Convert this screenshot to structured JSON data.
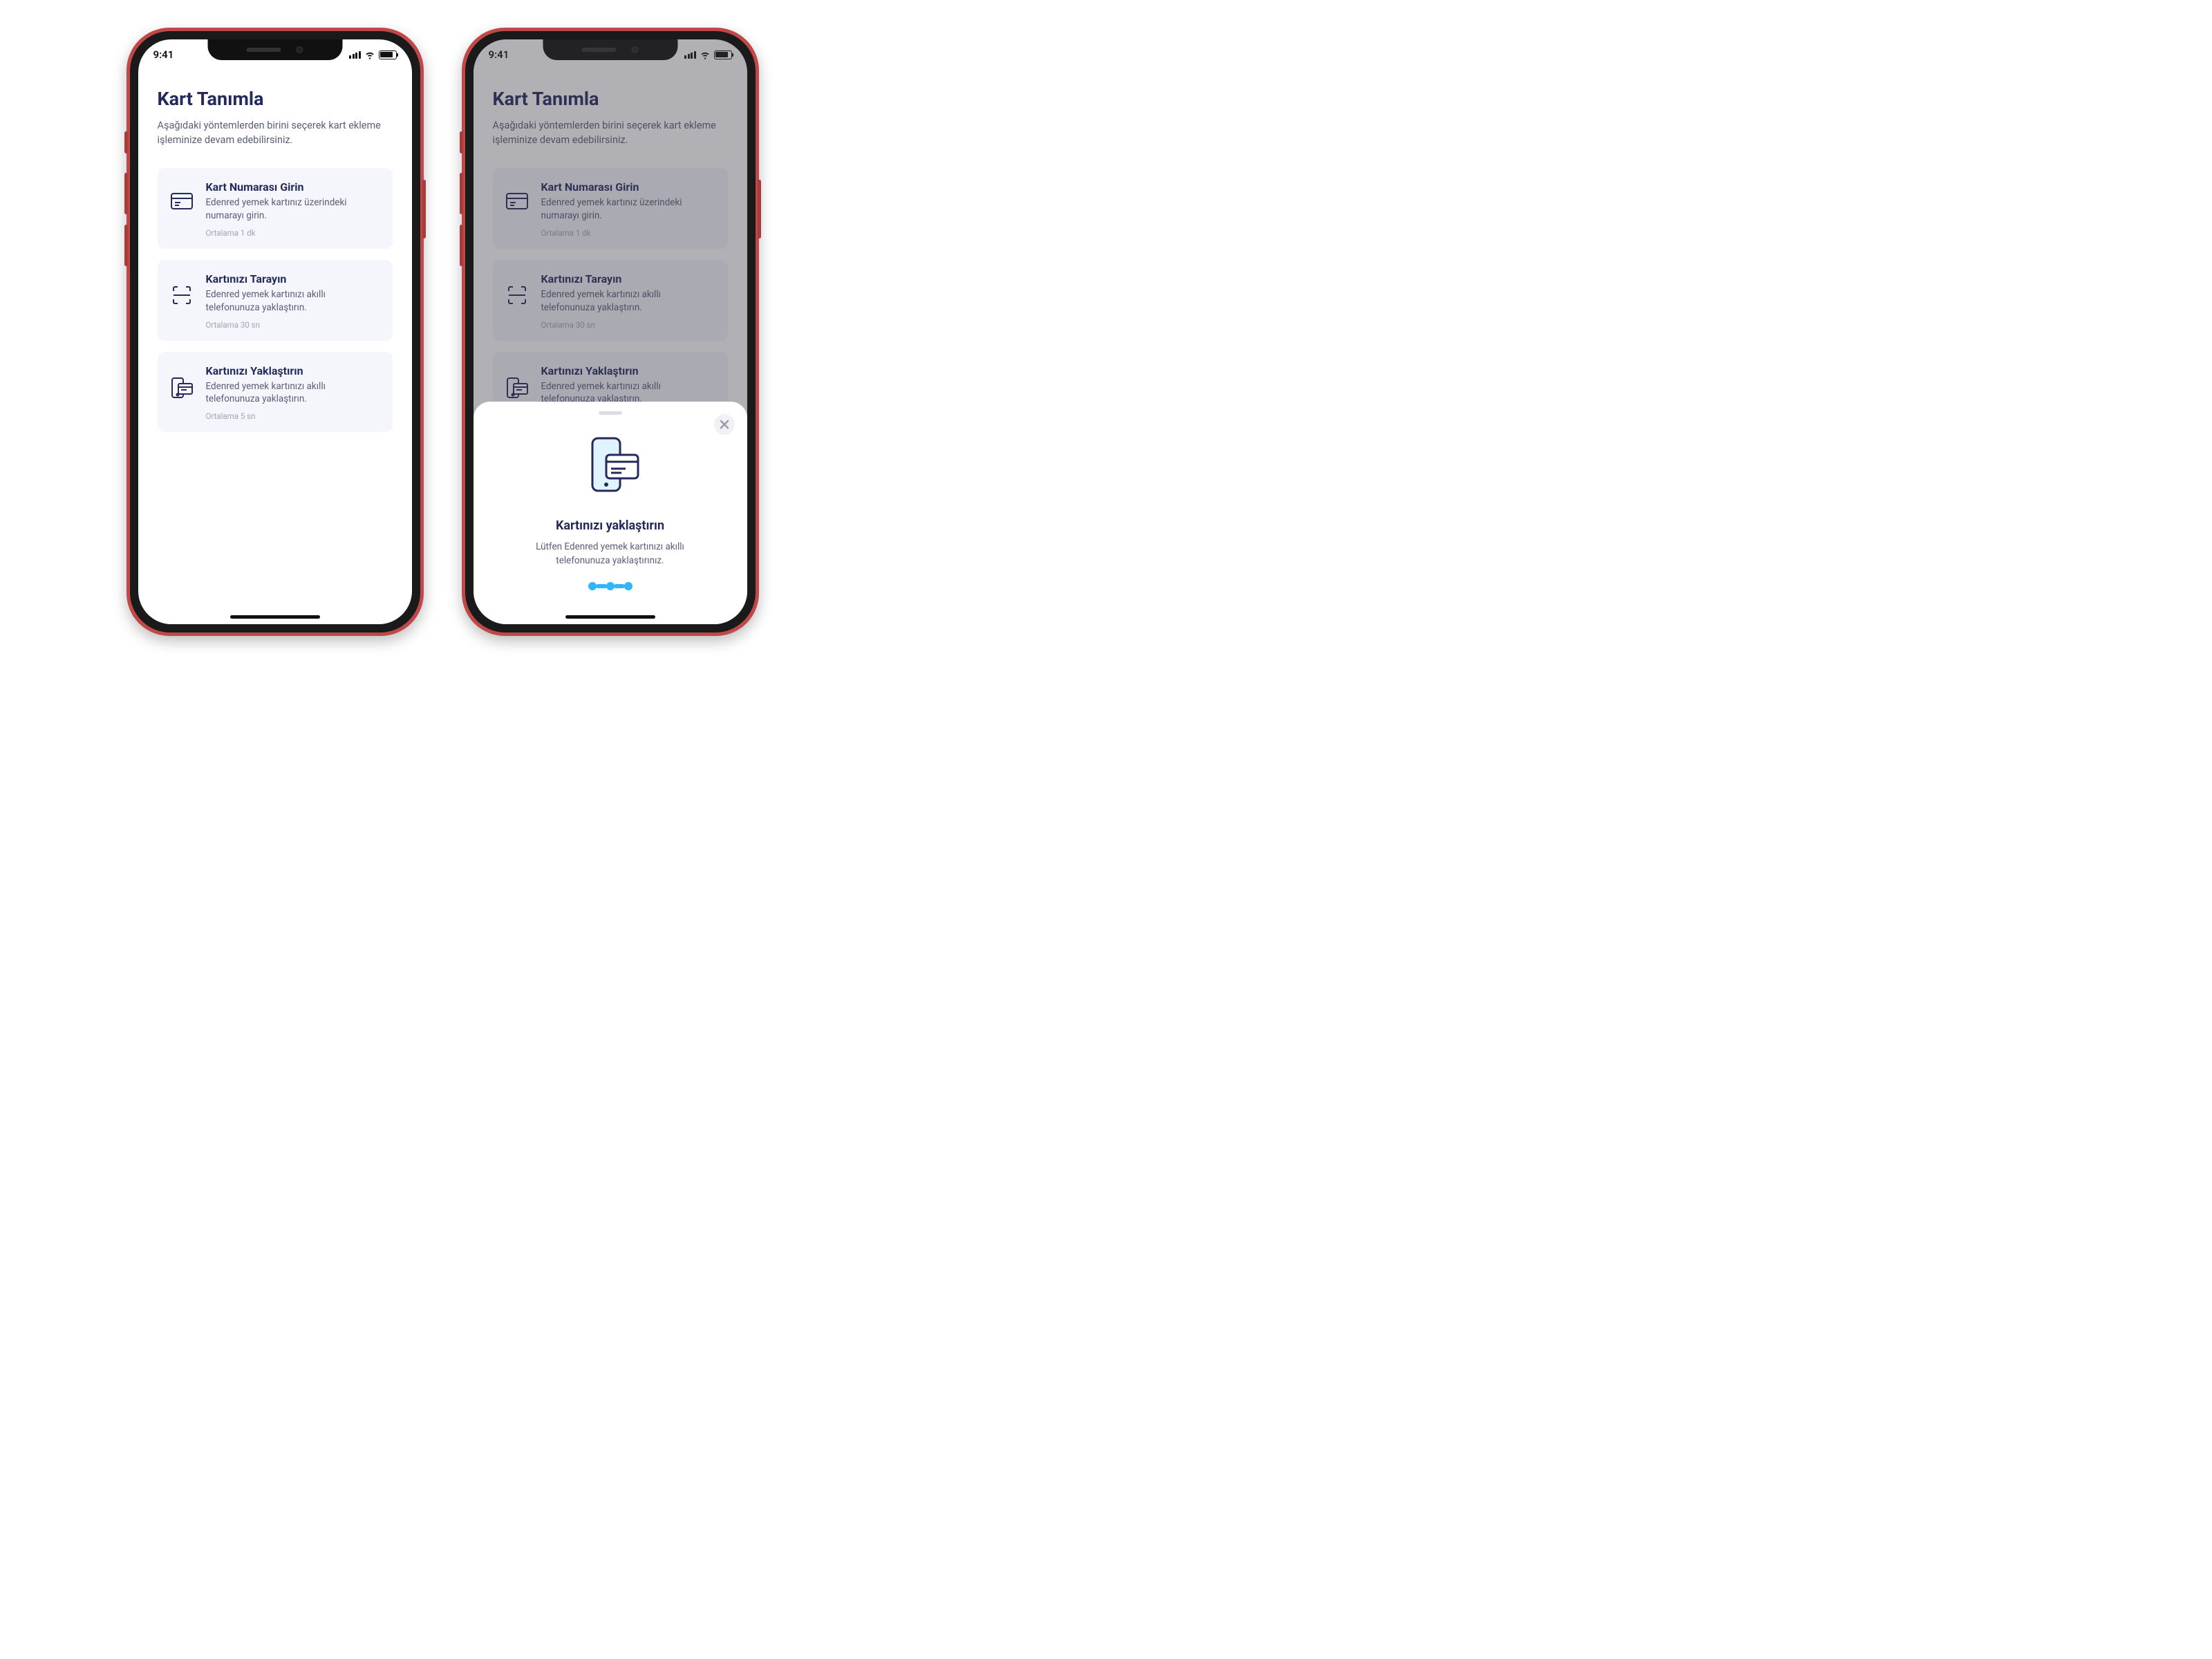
{
  "status": {
    "time": "9:41"
  },
  "page": {
    "title": "Kart Tanımla",
    "subtitle": "Aşağıdaki yöntemlerden birini seçerek kart ekleme işleminize devam edebilirsiniz."
  },
  "options": [
    {
      "title": "Kart Numarası Girin",
      "desc": "Edenred yemek kartınız üzerindeki numarayı girin.",
      "meta": "Ortalama 1 dk"
    },
    {
      "title": "Kartınızı Tarayın",
      "desc": "Edenred yemek kartınızı akıllı telefonunuza yaklaştırın.",
      "meta": "Ortalama 30 sn"
    },
    {
      "title": "Kartınızı Yaklaştırın",
      "desc": "Edenred yemek kartınızı akıllı telefonunuza yaklaştırın.",
      "meta": "Ortalama 5 sn"
    }
  ],
  "sheet": {
    "title": "Kartınızı yaklaştırın",
    "desc": "Lütfen Edenred yemek kartınızı akıllı telefonunuza yaklaştırınız."
  },
  "colors": {
    "primary_text": "#252a5c",
    "secondary_text": "#5a5e78",
    "option_bg": "#f4f6fb",
    "sheet_accent": "#32b5ff",
    "phone_body": "#c04848"
  }
}
